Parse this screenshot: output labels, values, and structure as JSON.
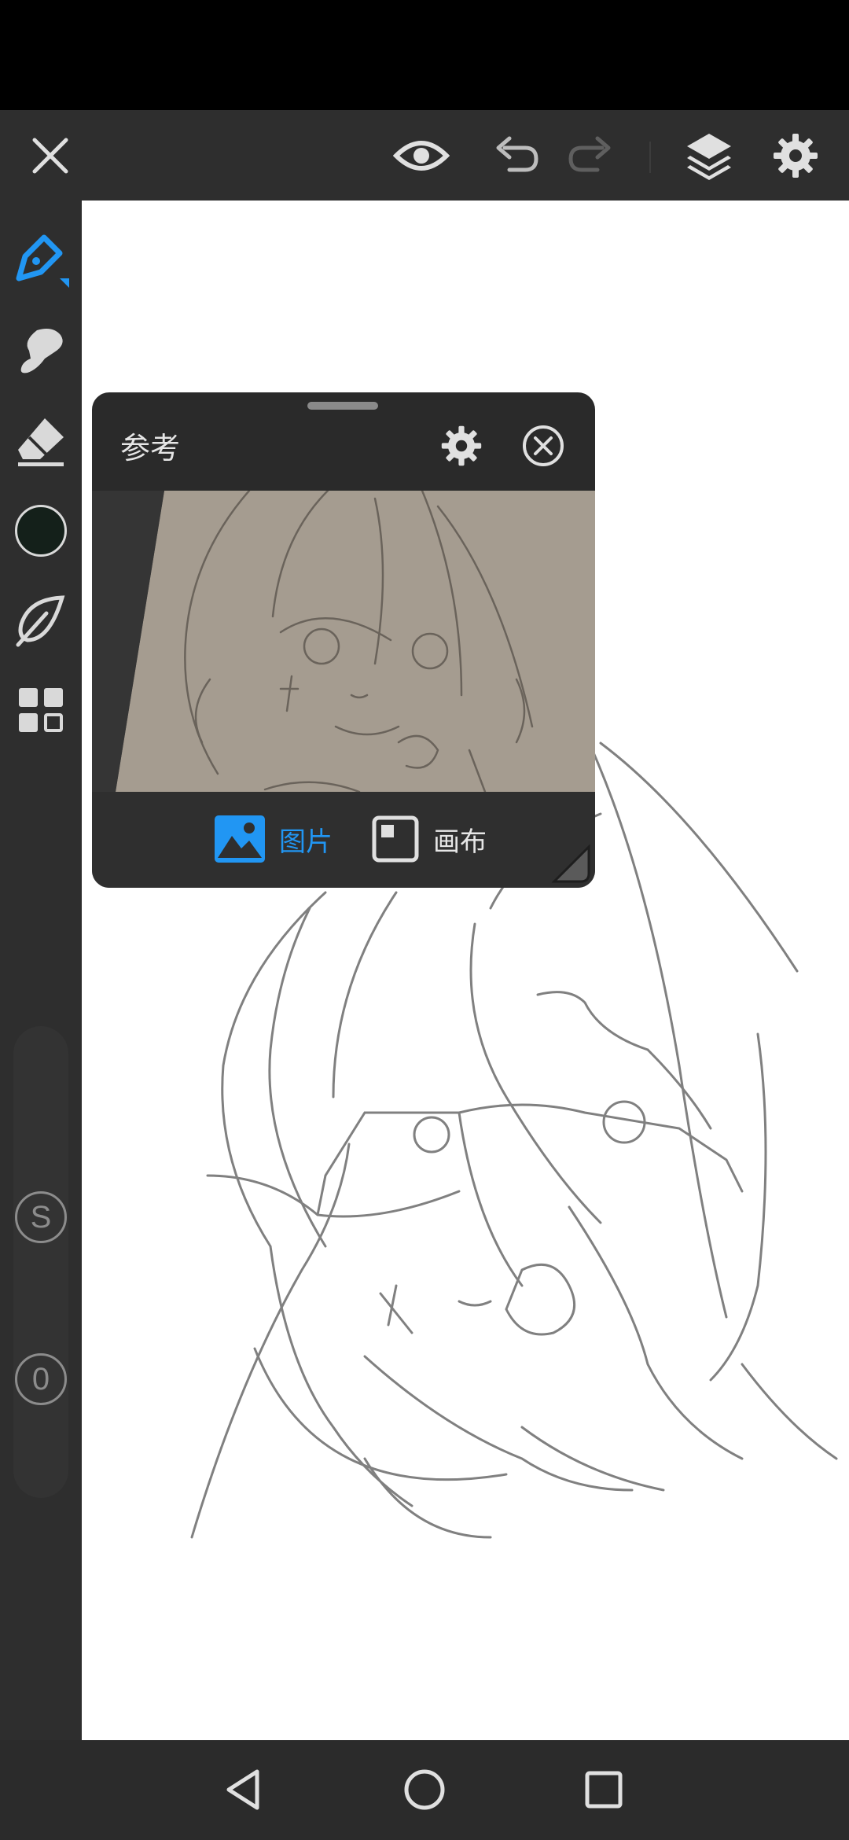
{
  "app": {
    "accent_color": "#2196f3",
    "toolbar_background": "#2e2e2e"
  },
  "top_toolbar": {
    "icons": [
      "close-icon",
      "eye-icon",
      "undo-icon",
      "redo-icon",
      "layers-icon",
      "settings-icon"
    ]
  },
  "left_toolbar": {
    "tools": [
      "pen-icon",
      "smudge-icon",
      "eraser-icon",
      "color-swatch",
      "leaf-icon",
      "grid-icon"
    ],
    "current_color": "#14201a",
    "size_slider_label": "S",
    "opacity_slider_label": "0"
  },
  "reference_panel": {
    "title": "参考",
    "tabs": [
      {
        "label": "图片",
        "active": true
      },
      {
        "label": "画布",
        "active": false
      }
    ]
  },
  "nav_bar": {
    "icons": [
      "back-icon",
      "home-icon",
      "recents-icon"
    ]
  }
}
